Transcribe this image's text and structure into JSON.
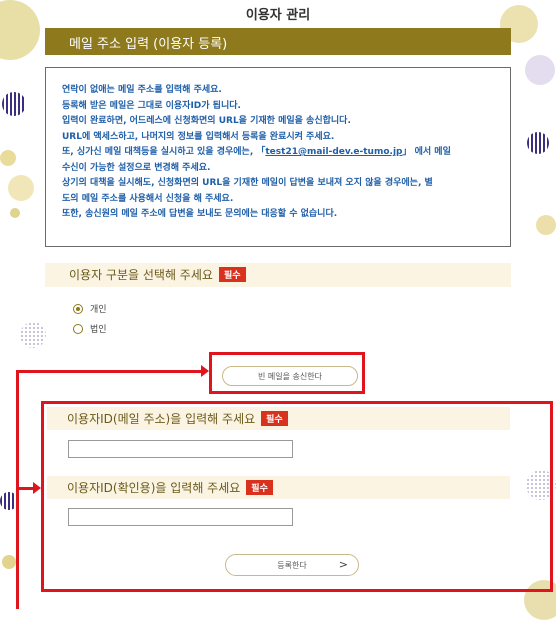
{
  "page": {
    "title": "이용자 관리"
  },
  "section": {
    "title": "메일 주소 입력 (이용자 등록)"
  },
  "info": {
    "lines": [
      "연락이 없애는 메일 주소를 입력해 주세요.",
      "등록해 받은 메일은 그대로 이용자ID가 됩니다.",
      "입력이 완료하면, 어드레스에 신청화면의 URL을 기재한 메일을 송신합니다.",
      "URL에 액세스하고, 나머지의 정보를 입력해서 등록을 완료시켜 주세요."
    ],
    "line5_prefix": "또, 싱가신 메일 대책등을 실시하고 있을 경우에는, 「",
    "email": "test21@mail-dev.e-tumo.jp",
    "line5_suffix": "」 에서 메일",
    "lines_after": [
      "수신이 가능한 설정으로 변경해 주세요.",
      "상기의 대책을 실시해도, 신청화면의 URL을 기재한 메일이 답변을 보내져 오지 않을 경우에는, 별",
      "도의 메일 주소를 사용해서 신청을 해 주세요.",
      "또한, 송신원의 메일 주소에 답변을 보내도 문의에는 대응할 수 없습니다."
    ]
  },
  "user_type": {
    "heading": "이용자 구분을 선택해 주세요",
    "badge": "필수",
    "options": [
      {
        "label": "개인",
        "checked": true
      },
      {
        "label": "법인",
        "checked": false
      }
    ]
  },
  "send_button": {
    "label": "빈 메일을 송신한다"
  },
  "userid": {
    "heading": "이용자ID(메일 주소)을 입력해 주세요",
    "badge": "필수",
    "value": ""
  },
  "userid_confirm": {
    "heading": "이용자ID(확인용)을 입력해 주세요",
    "badge": "필수",
    "value": ""
  },
  "register_button": {
    "label": "등록한다",
    "arrow": ">"
  },
  "colors": {
    "accent": "#8e7a1c",
    "badge": "#d8311e",
    "annotation": "#e0141c",
    "info_text": "#1f5fa8"
  }
}
